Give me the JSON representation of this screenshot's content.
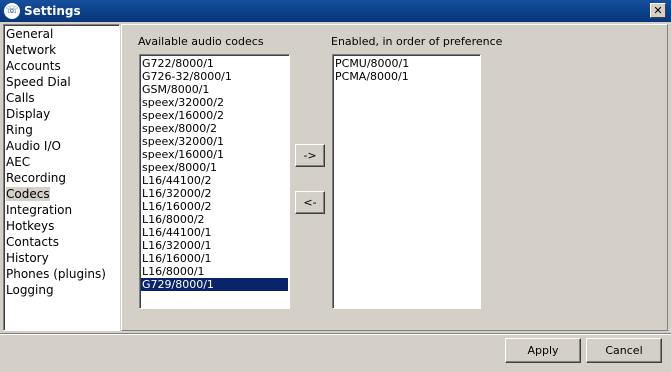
{
  "window": {
    "title": "Settings"
  },
  "sidebar": {
    "items": [
      {
        "label": "General"
      },
      {
        "label": "Network"
      },
      {
        "label": "Accounts"
      },
      {
        "label": "Speed Dial"
      },
      {
        "label": "Calls"
      },
      {
        "label": "Display"
      },
      {
        "label": "Ring"
      },
      {
        "label": "Audio I/O"
      },
      {
        "label": "AEC"
      },
      {
        "label": "Recording"
      },
      {
        "label": "Codecs"
      },
      {
        "label": "Integration"
      },
      {
        "label": "Hotkeys"
      },
      {
        "label": "Contacts"
      },
      {
        "label": "History"
      },
      {
        "label": "Phones (plugins)"
      },
      {
        "label": "Logging"
      }
    ],
    "active": "Codecs"
  },
  "codecs": {
    "available_label": "Available audio codecs",
    "enabled_label": "Enabled, in order of preference",
    "available": [
      "G722/8000/1",
      "G726-32/8000/1",
      "GSM/8000/1",
      "speex/32000/2",
      "speex/16000/2",
      "speex/8000/2",
      "speex/32000/1",
      "speex/16000/1",
      "speex/8000/1",
      "L16/44100/2",
      "L16/32000/2",
      "L16/16000/2",
      "L16/8000/2",
      "L16/44100/1",
      "L16/32000/1",
      "L16/16000/1",
      "L16/8000/1",
      "G729/8000/1"
    ],
    "selected_available": "G729/8000/1",
    "enabled": [
      "PCMU/8000/1",
      "PCMA/8000/1"
    ],
    "move_right_label": "->",
    "move_left_label": "<-"
  },
  "footer": {
    "apply_label": "Apply",
    "cancel_label": "Cancel"
  },
  "icons": {
    "app": "phone-icon",
    "close": "close-icon"
  }
}
